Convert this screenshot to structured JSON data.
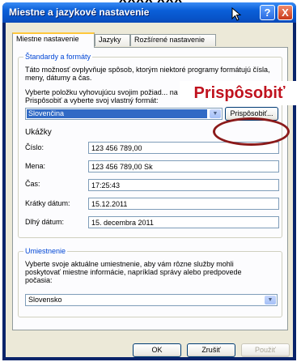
{
  "caption": "XXX̅X XXX",
  "window": {
    "title": "Miestne a jazykové nastavenie",
    "help_label": "?",
    "close_label": "X"
  },
  "tabs": [
    {
      "label": "Miestne nastavenie",
      "active": true
    },
    {
      "label": "Jazyky",
      "active": false
    },
    {
      "label": "Rozšírené nastavenie",
      "active": false
    }
  ],
  "standards": {
    "title": "Štandardy a formáty",
    "description": "Táto možnosť ovplyvňuje spôsob, ktorým niektoré programy formátujú čísla, meny, dátumy a čas.",
    "instruction": "Vyberte položku vyhovujúcu svojim požiad... na tlačidlo Prispôsobiť a vyberte svoj vlastný formát:",
    "selected_format": "Slovenčina",
    "customize_button": "Prispôsobiť...",
    "samples_title": "Ukážky",
    "samples": [
      {
        "label": "Číslo:",
        "value": "123 456 789,00"
      },
      {
        "label": "Mena:",
        "value": "123 456 789,00 Sk"
      },
      {
        "label": "Čas:",
        "value": "17:25:43"
      },
      {
        "label": "Krátky dátum:",
        "value": "15.12.2011"
      },
      {
        "label": "Dlhý dátum:",
        "value": "15. decembra 2011"
      }
    ]
  },
  "location": {
    "title": "Umiestnenie",
    "description": "Vyberte svoje aktuálne umiestnenie, aby vám rôzne služby mohli poskytovať miestne informácie, napríklad správy alebo predpovede počasia:",
    "selected_location": "Slovensko"
  },
  "footer": {
    "ok_label": "OK",
    "cancel_label": "Zrušiť",
    "apply_label": "Použiť"
  },
  "callout": {
    "text": "Prispôsobiť",
    "color": "#c0121e"
  },
  "colors": {
    "titlebar": "#0a5fd8",
    "group_title": "#0046d5",
    "selection": "#316ac5"
  }
}
